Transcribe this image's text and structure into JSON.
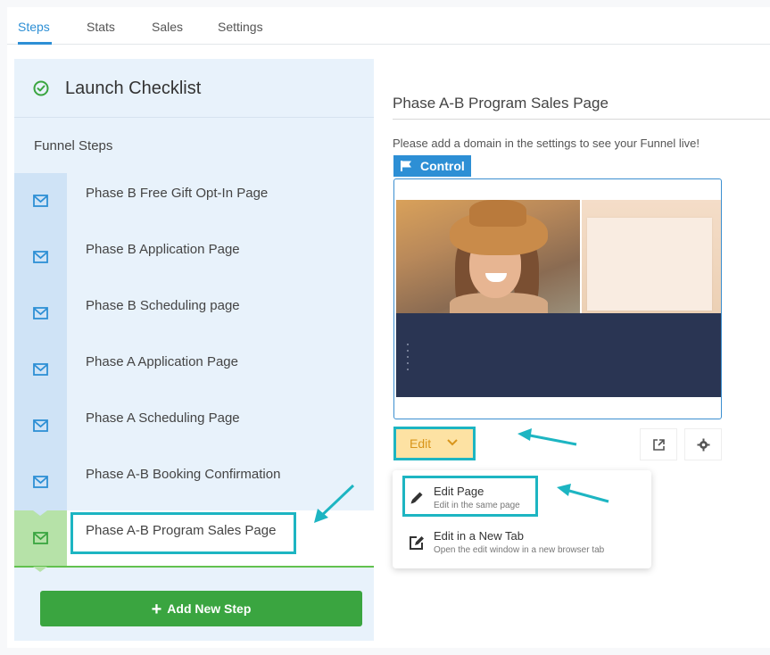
{
  "tabs": [
    {
      "label": "Steps",
      "active": true
    },
    {
      "label": "Stats",
      "active": false
    },
    {
      "label": "Sales",
      "active": false
    },
    {
      "label": "Settings",
      "active": false
    }
  ],
  "sidebar": {
    "checklist_title": "Launch Checklist",
    "funnel_steps_label": "Funnel Steps",
    "steps": [
      {
        "label": "Phase B Free Gift Opt-In Page",
        "active": false
      },
      {
        "label": "Phase B Application Page",
        "active": false
      },
      {
        "label": "Phase B Scheduling page",
        "active": false
      },
      {
        "label": "Phase A Application Page",
        "active": false
      },
      {
        "label": "Phase A Scheduling Page",
        "active": false
      },
      {
        "label": "Phase A-B Booking Confirmation",
        "active": false
      },
      {
        "label": "Phase A-B Program Sales Page",
        "active": true
      }
    ],
    "add_step_label": "Add New Step"
  },
  "main": {
    "page_title": "Phase A-B Program Sales Page",
    "domain_note": "Please add a domain in the settings to see your Funnel live!",
    "control_label": "Control",
    "edit_label": "Edit",
    "dropdown": [
      {
        "title": "Edit Page",
        "subtitle": "Edit in the same page",
        "icon": "pencil-icon"
      },
      {
        "title": "Edit in a New Tab",
        "subtitle": "Open the edit window in a new browser tab",
        "icon": "edit-box-icon"
      }
    ]
  },
  "colors": {
    "accent": "#2d8fd5",
    "highlight": "#1db5c2",
    "add_button": "#3aa540",
    "active_step": "#b6e2a8"
  }
}
